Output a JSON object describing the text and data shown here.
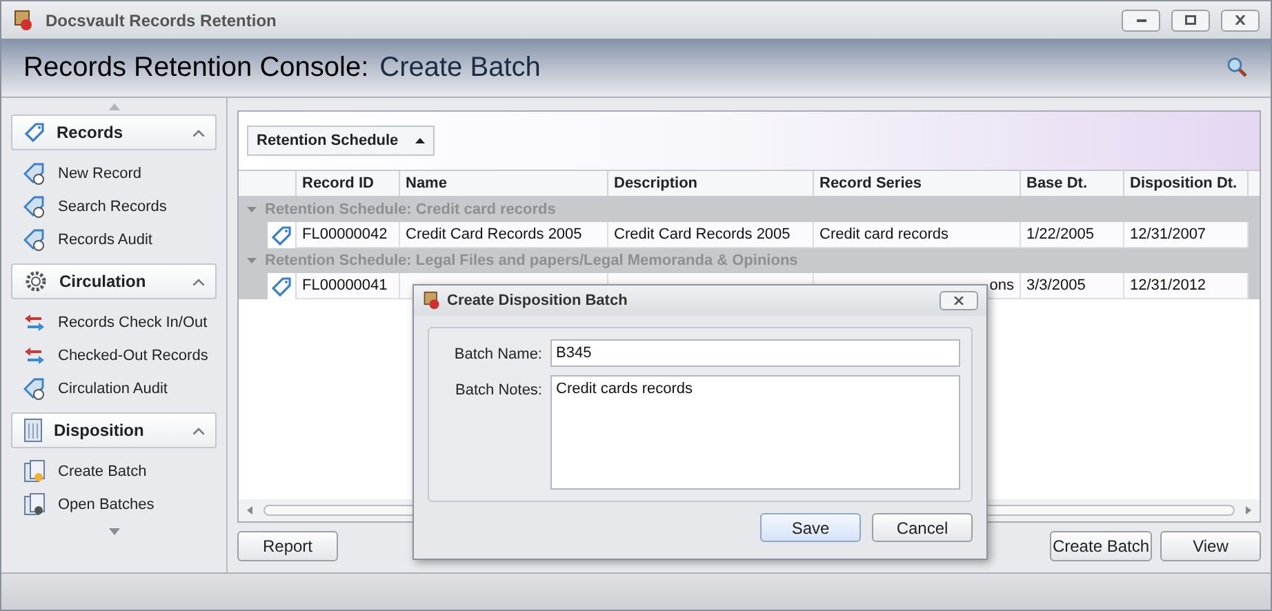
{
  "window": {
    "title": "Docsvault Records Retention"
  },
  "header": {
    "title": "Records Retention Console:",
    "subtitle": "Create Batch"
  },
  "sidebar": {
    "sections": [
      {
        "title": "Records",
        "expanded": true,
        "items": [
          {
            "label": "New Record"
          },
          {
            "label": "Search Records"
          },
          {
            "label": "Records Audit"
          }
        ]
      },
      {
        "title": "Circulation",
        "expanded": true,
        "items": [
          {
            "label": "Records Check In/Out"
          },
          {
            "label": "Checked-Out Records"
          },
          {
            "label": "Circulation Audit"
          }
        ]
      },
      {
        "title": "Disposition",
        "expanded": true,
        "items": [
          {
            "label": "Create Batch"
          },
          {
            "label": "Open Batches"
          }
        ]
      }
    ]
  },
  "group_by": {
    "label": "Retention Schedule"
  },
  "table": {
    "columns": [
      "Record ID",
      "Name",
      "Description",
      "Record Series",
      "Base Dt.",
      "Disposition Dt."
    ],
    "groups": [
      {
        "title": "Retention Schedule: Credit card records",
        "expanded": true,
        "rows": [
          [
            "FL00000042",
            "Credit Card Records 2005",
            "Credit Card Records 2005",
            "Credit card records",
            "1/22/2005",
            "12/31/2007"
          ]
        ]
      },
      {
        "title": "Retention Schedule: Legal Files and papers/Legal Memoranda & Opinions",
        "expanded": true,
        "rows": [
          [
            "FL00000041",
            "",
            "",
            "ons",
            "3/3/2005",
            "12/31/2012"
          ]
        ]
      }
    ]
  },
  "buttons_left": [
    "Report"
  ],
  "buttons_right": [
    "Create Batch",
    "View"
  ],
  "dialog": {
    "title": "Create Disposition Batch",
    "fields": [
      {
        "label": "Batch Name:",
        "value": "B345",
        "kind": "line"
      },
      {
        "label": "Batch Notes:",
        "value": "Credit cards records ",
        "kind": "area"
      }
    ],
    "buttons": [
      {
        "label": "Save",
        "selected": true
      },
      {
        "label": "Cancel",
        "selected": false
      }
    ]
  }
}
